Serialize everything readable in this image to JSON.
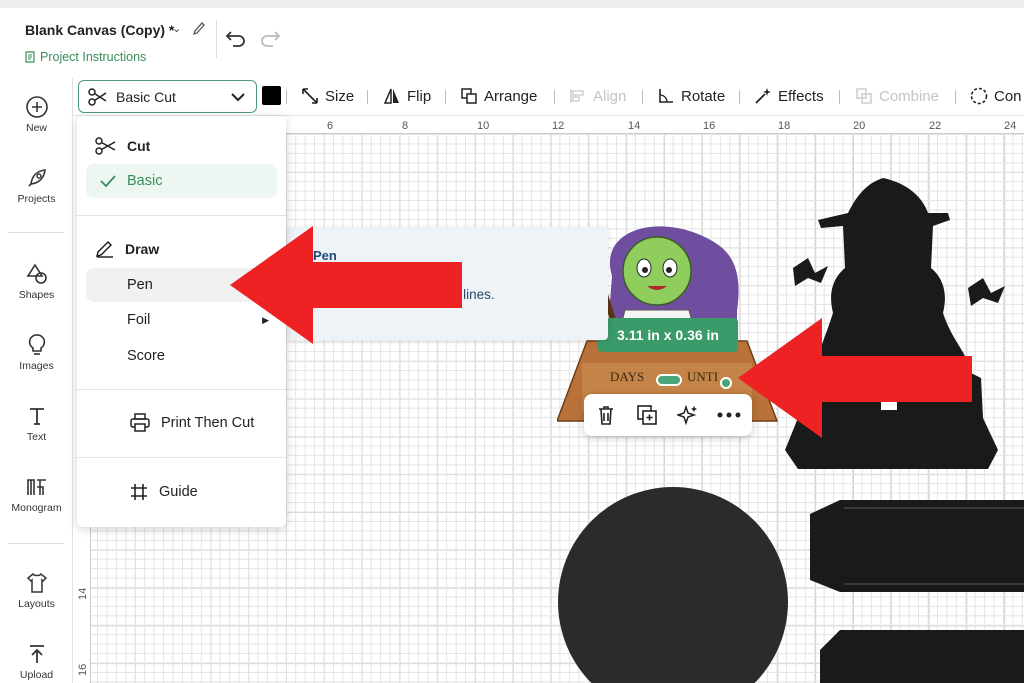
{
  "header": {
    "title": "Blank Canvas (Copy) *",
    "project_instructions": "Project Instructions"
  },
  "sidebar": {
    "items": [
      {
        "label": "New",
        "icon": "plus-circle-icon"
      },
      {
        "label": "Projects",
        "icon": "rocket-icon"
      },
      {
        "label": "Shapes",
        "icon": "shapes-icon"
      },
      {
        "label": "Images",
        "icon": "lightbulb-icon"
      },
      {
        "label": "Text",
        "icon": "text-icon"
      },
      {
        "label": "Monogram",
        "icon": "monogram-icon"
      },
      {
        "label": "Layouts",
        "icon": "shirt-icon"
      },
      {
        "label": "Upload",
        "icon": "upload-icon"
      }
    ]
  },
  "toolbar": {
    "operation": "Basic Cut",
    "swatch_color": "#000000",
    "size": "Size",
    "flip": "Flip",
    "arrange": "Arrange",
    "align": "Align",
    "rotate": "Rotate",
    "effects": "Effects",
    "combine": "Combine",
    "contour": "Con"
  },
  "ruler": {
    "top": [
      "6",
      "8",
      "10",
      "12",
      "14",
      "16",
      "18",
      "20",
      "22",
      "24"
    ],
    "left": [
      "14",
      "16"
    ]
  },
  "dropdown": {
    "cut_header": "Cut",
    "basic": "Basic",
    "draw_header": "Draw",
    "pen": "Pen",
    "foil": "Foil",
    "score": "Score",
    "print_then_cut": "Print Then Cut",
    "guide": "Guide"
  },
  "tooltip": {
    "title": "Pen",
    "body": "h pen, score, or engrave lines."
  },
  "selection": {
    "dimensions": "3.11  in x 0.36  in"
  },
  "canvas_text": {
    "days": "DAYS",
    "until": "UNTI"
  },
  "colors": {
    "accent": "#3a8c5c",
    "arrow": "#ee2222",
    "silhouette": "#1a1a1a"
  }
}
